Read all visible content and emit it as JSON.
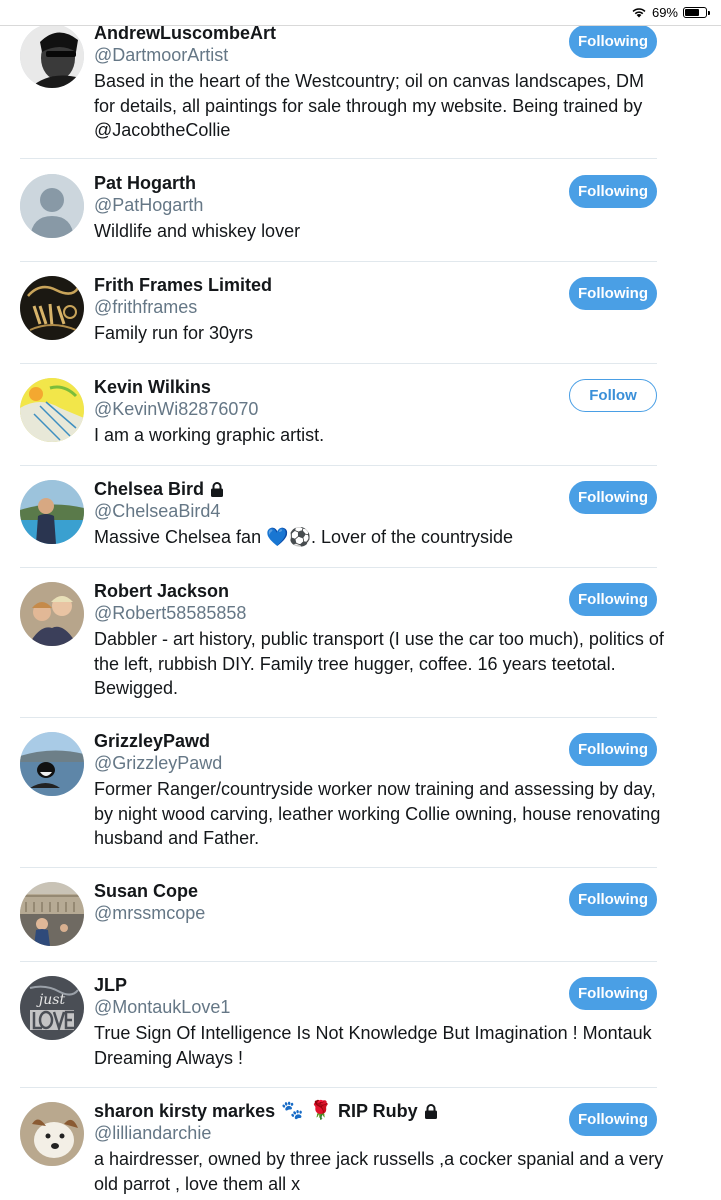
{
  "status_bar": {
    "battery_text": "69%",
    "battery_level": 0.69
  },
  "users": [
    {
      "name": "AndrewLuscombeArt",
      "handle": "@DartmoorArtist",
      "bio": "Based in the heart of the Westcountry; oil on canvas landscapes, DM for details, all paintings for sale through my website. Being trained by @JacobtheCollie",
      "button": "Following",
      "following": true,
      "avatar": "dark-portrait"
    },
    {
      "name": "Pat Hogarth",
      "handle": "@PatHogarth",
      "bio": "Wildlife and whiskey lover",
      "button": "Following",
      "following": true,
      "avatar": "default-silhouette"
    },
    {
      "name": "Frith Frames Limited",
      "handle": "@frithframes",
      "bio": "Family run for 30yrs",
      "button": "Following",
      "following": true,
      "avatar": "art-logo"
    },
    {
      "name": "Kevin Wilkins",
      "handle": "@KevinWi82876070",
      "bio": "I am a working graphic artist.",
      "button": "Follow",
      "following": false,
      "avatar": "yellow-sketch"
    },
    {
      "name": "Chelsea Bird",
      "handle": "@ChelseaBird4",
      "bio_parts": [
        "Massive Chelsea fan ",
        "💙",
        "⚽",
        ". Lover of the countryside"
      ],
      "button": "Following",
      "following": true,
      "avatar": "pool-photo",
      "locked": true
    },
    {
      "name": "Robert Jackson",
      "handle": "@Robert58585858",
      "bio": "Dabbler - art history, public transport (I use the car too much), politics of the left, rubbish DIY. Family tree hugger, coffee. 16 years teetotal. Bewigged.",
      "button": "Following",
      "following": true,
      "avatar": "couple-photo"
    },
    {
      "name": "GrizzleyPawd",
      "handle": "@GrizzleyPawd",
      "bio": "Former Ranger/countryside worker now training and assessing by day, by night wood carving, leather working Collie owning, house renovating husband and Father.",
      "button": "Following",
      "following": true,
      "avatar": "dog-lake"
    },
    {
      "name": "Susan Cope",
      "handle": "@mrssmcope",
      "bio": "",
      "button": "Following",
      "following": true,
      "avatar": "palace-photo"
    },
    {
      "name": "JLP",
      "handle": "@MontaukLove1",
      "bio": "True Sign Of Intelligence Is Not Knowledge But Imagination ! Montauk Dreaming Always !",
      "button": "Following",
      "following": true,
      "avatar": "just-love"
    },
    {
      "name_parts": [
        "sharon kirsty markes ",
        "🐾",
        "🌹",
        " RIP Ruby"
      ],
      "handle": "@lilliandarchie",
      "bio": "a hairdresser, owned by three jack russells ,a cocker spanial and a very old parrot , love them all x",
      "button": "Following",
      "following": true,
      "avatar": "jack-russell",
      "locked": true
    }
  ]
}
